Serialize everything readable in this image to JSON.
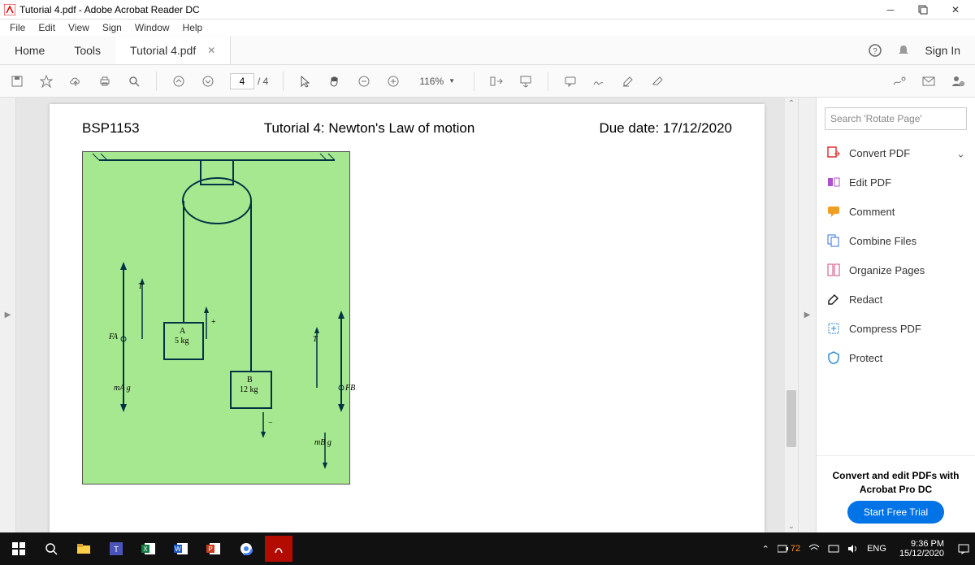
{
  "window": {
    "title": "Tutorial 4.pdf - Adobe Acrobat Reader DC"
  },
  "menu": {
    "file": "File",
    "edit": "Edit",
    "view": "View",
    "sign": "Sign",
    "window": "Window",
    "help": "Help"
  },
  "tabs": {
    "home": "Home",
    "tools": "Tools",
    "doc": "Tutorial 4.pdf",
    "signin": "Sign In"
  },
  "toolbar": {
    "page_current": "4",
    "page_total": "/ 4",
    "zoom": "116%"
  },
  "doc": {
    "left": "BSP1153",
    "center": "Tutorial 4: Newton's Law of motion",
    "right": "Due date: 17/12/2020",
    "fig": {
      "A_label": "A",
      "A_mass": "5 kg",
      "B_label": "B",
      "B_mass": "12 kg",
      "T": "T",
      "FA": "FA",
      "FB": "FB",
      "mAg": "mA g",
      "mBg": "mB g",
      "plus": "+",
      "minus": "−"
    }
  },
  "sidebar": {
    "search_placeholder": "Search 'Rotate Page'",
    "tools": [
      {
        "label": "Convert PDF",
        "color": "#d33"
      },
      {
        "label": "Edit PDF",
        "color": "#b050d0"
      },
      {
        "label": "Comment",
        "color": "#f0a020"
      },
      {
        "label": "Combine Files",
        "color": "#3a6fd8"
      },
      {
        "label": "Organize Pages",
        "color": "#d04a7a"
      },
      {
        "label": "Redact",
        "color": "#222"
      },
      {
        "label": "Compress PDF",
        "color": "#3388cc"
      },
      {
        "label": "Protect",
        "color": "#3388cc"
      }
    ],
    "trial_text": "Convert and edit PDFs with Acrobat Pro DC",
    "trial_btn": "Start Free Trial"
  },
  "taskbar": {
    "battery": "72",
    "lang": "ENG",
    "time": "9:36 PM",
    "date": "15/12/2020"
  }
}
